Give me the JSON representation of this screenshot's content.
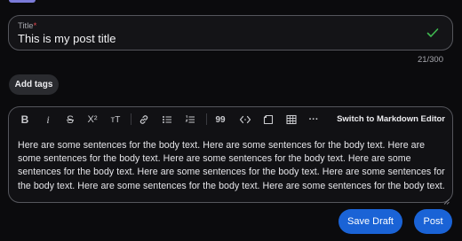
{
  "title_field": {
    "label": "Title",
    "required_mark": "*",
    "value": "This is my post title",
    "valid_icon": "check-icon",
    "char_count": "21/300"
  },
  "tags": {
    "add_label": "Add tags"
  },
  "toolbar": {
    "tools": [
      {
        "name": "bold",
        "icon": "bold-icon",
        "glyph": "B"
      },
      {
        "name": "italic",
        "icon": "italic-icon",
        "glyph": "i"
      },
      {
        "name": "strikethrough",
        "icon": "strikethrough-icon",
        "glyph": "S"
      },
      {
        "name": "superscript",
        "icon": "superscript-icon",
        "glyph": "X²"
      },
      {
        "name": "heading",
        "icon": "heading-icon",
        "glyph": "ᴛT"
      },
      {
        "name": "link",
        "icon": "link-icon"
      },
      {
        "name": "bulleted-list",
        "icon": "bullet-list-icon"
      },
      {
        "name": "numbered-list",
        "icon": "numbered-list-icon"
      },
      {
        "name": "quote",
        "icon": "quote-icon",
        "glyph": "99"
      },
      {
        "name": "code",
        "icon": "code-icon"
      },
      {
        "name": "code-block",
        "icon": "code-block-icon"
      },
      {
        "name": "table",
        "icon": "table-icon"
      },
      {
        "name": "more",
        "icon": "more-icon",
        "glyph": "···"
      }
    ],
    "markdown_switch_label": "Switch to Markdown Editor"
  },
  "body": {
    "text": "Here are some sentences for the body text. Here are some sentences for the body text. Here are some sentences for the body text. Here are some sentences for the body text. Here are some sentences for the body text. Here are some sentences for the body text. Here are some sentences for the body text. Here are some sentences for the body text. Here are some sentences for the body text."
  },
  "actions": {
    "save_draft_label": "Save Draft",
    "post_label": "Post"
  },
  "colors": {
    "accent": "#1a63d6",
    "valid": "#3fb950",
    "required": "#e5484d",
    "top_accent": "#7b7bd8"
  }
}
